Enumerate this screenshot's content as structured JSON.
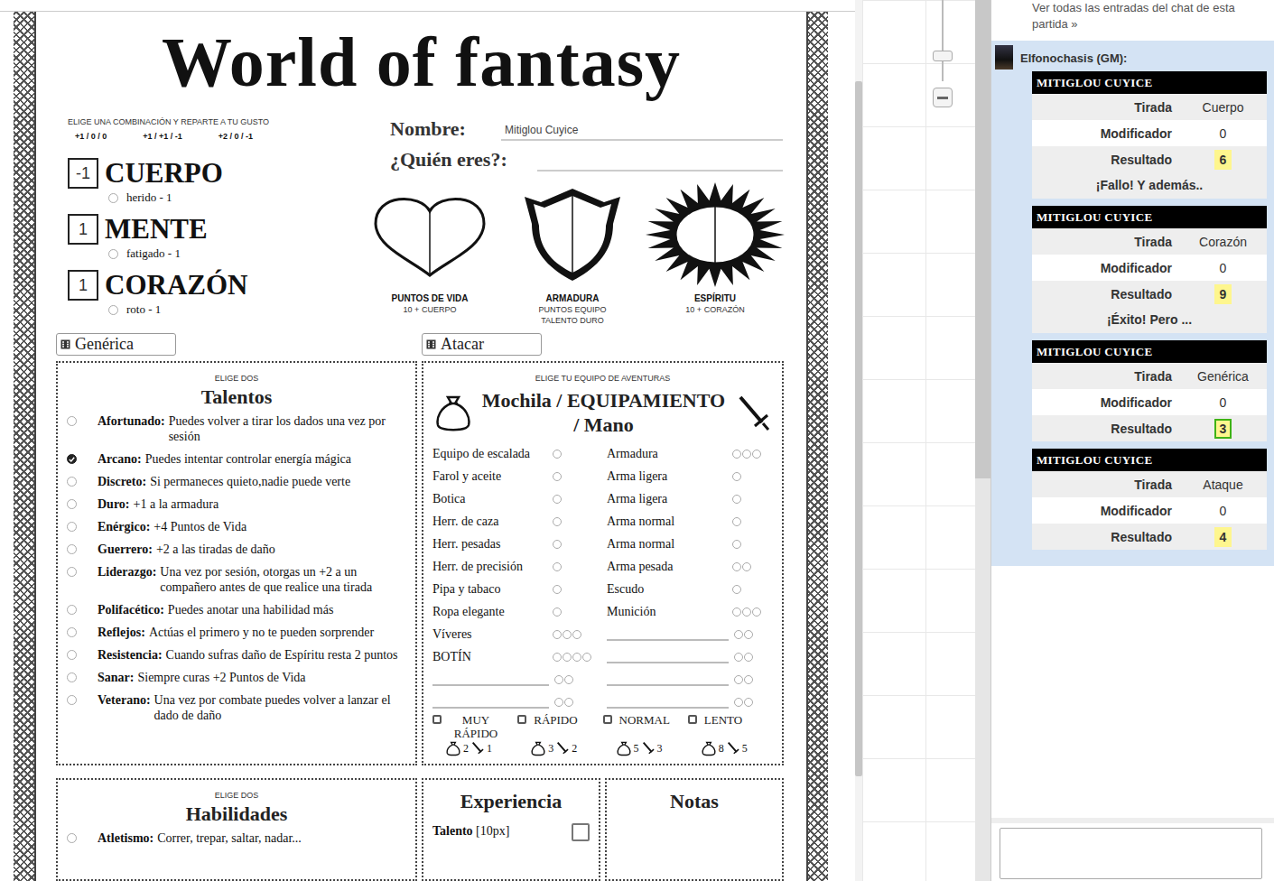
{
  "sheet": {
    "title": "World of fantasy",
    "stat_hint": "ELIGE UNA COMBINACIÓN Y REPARTE A TU GUSTO",
    "combos": [
      "+1 / 0 / 0",
      "+1 / +1 / -1",
      "+2 / 0 / -1"
    ],
    "stats": [
      {
        "value": "-1",
        "name": "CUERPO",
        "condition": "herido - 1",
        "checked": false
      },
      {
        "value": "1",
        "name": "MENTE",
        "condition": "fatigado - 1",
        "checked": false
      },
      {
        "value": "1",
        "name": "CORAZÓN",
        "condition": "roto - 1",
        "checked": false
      }
    ],
    "name": {
      "label": "Nombre:",
      "value": "Mitiglou Cuyice"
    },
    "who": {
      "label": "¿Quién eres?:",
      "value": ""
    },
    "emblems": [
      {
        "kind": "heart",
        "title": "PUNTOS DE VIDA",
        "lines": [
          "10 + CUERPO"
        ]
      },
      {
        "kind": "shield",
        "title": "ARMADURA",
        "lines": [
          "PUNTOS EQUIPO",
          "TALENTO DURO"
        ]
      },
      {
        "kind": "sun",
        "title": "ESPÍRITU",
        "lines": [
          "10 + CORAZÓN"
        ]
      }
    ],
    "roll_buttons": [
      "Genérica",
      "Atacar"
    ],
    "talents": {
      "hint": "ELIGE DOS",
      "title": "Talentos",
      "items": [
        {
          "name": "Afortunado:",
          "desc": "Puedes volver a tirar los dados una vez por sesión",
          "checked": false
        },
        {
          "name": "Arcano:",
          "desc": "Puedes intentar controlar energía mágica",
          "checked": true
        },
        {
          "name": "Discreto:",
          "desc": "Si permaneces quieto,nadie puede verte",
          "checked": false
        },
        {
          "name": "Duro:",
          "desc": "+1 a la armadura",
          "checked": false
        },
        {
          "name": "Enérgico:",
          "desc": "+4 Puntos de Vida",
          "checked": false
        },
        {
          "name": "Guerrero:",
          "desc": "+2 a las tiradas de daño",
          "checked": false
        },
        {
          "name": "Liderazgo:",
          "desc": "Una vez por sesión, otorgas un +2 a un compañero antes de que realice una tirada",
          "checked": false
        },
        {
          "name": "Polifacético:",
          "desc": "Puedes anotar una habilidad más",
          "checked": false
        },
        {
          "name": "Reflejos:",
          "desc": "Actúas el primero y no te pueden sorprender",
          "checked": false
        },
        {
          "name": "Resistencia:",
          "desc": "Cuando sufras daño de Espíritu resta 2 puntos",
          "checked": false
        },
        {
          "name": "Sanar:",
          "desc": "Siempre curas +2 Puntos de Vida",
          "checked": false
        },
        {
          "name": "Veterano:",
          "desc": "Una vez por combate puedes volver a lanzar el dado de daño",
          "checked": false
        }
      ]
    },
    "equipment": {
      "hint": "ELIGE TU EQUIPO DE AVENTURAS",
      "title": "Mochila / EQUIPAMIENTO / Mano",
      "pack": [
        {
          "kind": "item",
          "label": "Equipo de escalada",
          "slots": 1
        },
        {
          "kind": "item",
          "label": "Farol y aceite",
          "slots": 1
        },
        {
          "kind": "item",
          "label": "Botica",
          "slots": 1
        },
        {
          "kind": "item",
          "label": "Herr. de caza",
          "slots": 1
        },
        {
          "kind": "item",
          "label": "Herr. pesadas",
          "slots": 1
        },
        {
          "kind": "item",
          "label": "Herr. de precisión",
          "slots": 1
        },
        {
          "kind": "item",
          "label": "Pipa y tabaco",
          "slots": 1
        },
        {
          "kind": "item",
          "label": "Ropa elegante",
          "slots": 1
        },
        {
          "kind": "item",
          "label": "Víveres",
          "slots": 3
        },
        {
          "kind": "item",
          "label": "BOTÍN",
          "slots": 4
        },
        {
          "kind": "blank",
          "label": "",
          "slots": 2
        },
        {
          "kind": "blank",
          "label": "",
          "slots": 2
        }
      ],
      "hand": [
        {
          "kind": "item",
          "label": "Armadura",
          "slots": 3
        },
        {
          "kind": "item",
          "label": "Arma ligera",
          "slots": 1
        },
        {
          "kind": "item",
          "label": "Arma ligera",
          "slots": 1
        },
        {
          "kind": "item",
          "label": "Arma normal",
          "slots": 1
        },
        {
          "kind": "item",
          "label": "Arma normal",
          "slots": 1
        },
        {
          "kind": "item",
          "label": "Arma pesada",
          "slots": 2
        },
        {
          "kind": "item",
          "label": "Escudo",
          "slots": 1
        },
        {
          "kind": "item",
          "label": "Munición",
          "slots": 3
        },
        {
          "kind": "blank",
          "label": "",
          "slots": 2
        },
        {
          "kind": "blank",
          "label": "",
          "slots": 2
        },
        {
          "kind": "blank",
          "label": "",
          "slots": 2
        },
        {
          "kind": "blank",
          "label": "",
          "slots": 2
        }
      ],
      "speeds": [
        {
          "label": "MUY RÁPIDO",
          "bag": "2",
          "sword": "1",
          "checked": false
        },
        {
          "label": "RÁPIDO",
          "bag": "3",
          "sword": "2",
          "checked": false
        },
        {
          "label": "NORMAL",
          "bag": "5",
          "sword": "3",
          "checked": false
        },
        {
          "label": "LENTO",
          "bag": "8",
          "sword": "5",
          "checked": false
        }
      ]
    },
    "skills": {
      "hint": "ELIGE DOS",
      "title": "Habilidades",
      "items": [
        {
          "name": "Atletismo:",
          "desc": "Correr, trepar, saltar, nadar...",
          "checked": false
        }
      ]
    },
    "experience": {
      "title": "Experiencia",
      "items": [
        {
          "name": "Talento",
          "cost": "[10px]",
          "checked": false
        }
      ]
    },
    "notes": {
      "title": "Notas"
    }
  },
  "canvas": {
    "zoom": {
      "level": 0.7
    }
  },
  "chat": {
    "history_link": "Ver todas las entradas del chat de esta partida »",
    "sender": "Elfonochasis (GM):",
    "labels": {
      "roll": "Tirada",
      "modifier": "Modificador",
      "result": "Resultado"
    },
    "rolls": [
      {
        "character": "MITIGLOU CUYICE",
        "roll": "Cuerpo",
        "modifier": "0",
        "result": "6",
        "critical": false,
        "outcome": "¡Fallo! Y además.."
      },
      {
        "character": "MITIGLOU CUYICE",
        "roll": "Corazón",
        "modifier": "0",
        "result": "9",
        "critical": false,
        "outcome": "¡Éxito! Pero ..."
      },
      {
        "character": "MITIGLOU CUYICE",
        "roll": "Genérica",
        "modifier": "0",
        "result": "3",
        "critical": true,
        "outcome": ""
      },
      {
        "character": "MITIGLOU CUYICE",
        "roll": "Ataque",
        "modifier": "0",
        "result": "4",
        "critical": false,
        "outcome": ""
      }
    ],
    "input": {
      "value": ""
    }
  }
}
